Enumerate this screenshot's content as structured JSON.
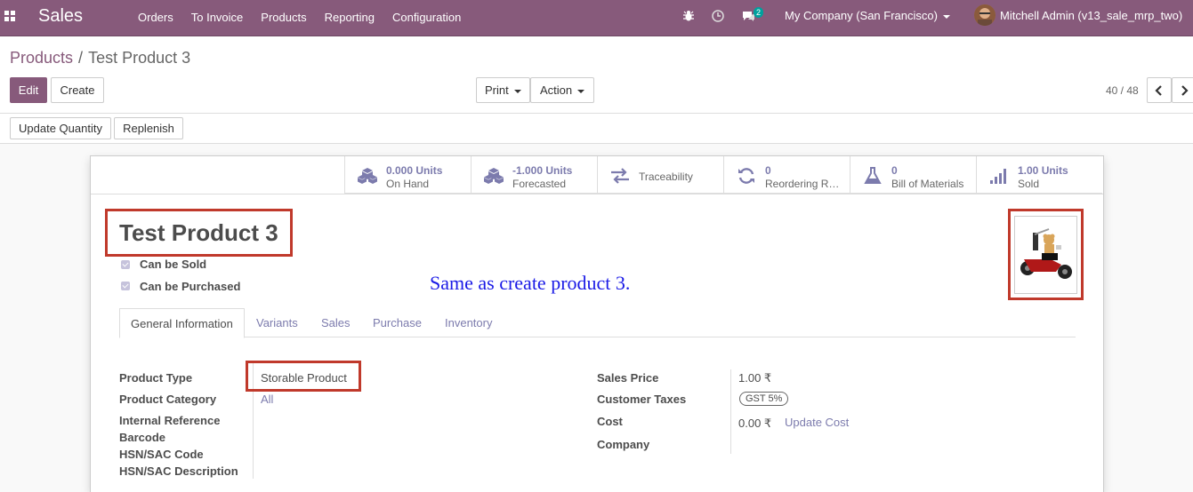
{
  "nav": {
    "app_name": "Sales",
    "menu": [
      "Orders",
      "To Invoice",
      "Products",
      "Reporting",
      "Configuration"
    ],
    "message_count": "2",
    "company": "My Company (San Francisco)",
    "user": "Mitchell Admin (v13_sale_mrp_two)"
  },
  "breadcrumb": {
    "parent": "Products",
    "separator": "/",
    "current": "Test Product 3"
  },
  "buttons": {
    "edit": "Edit",
    "create": "Create",
    "print": "Print",
    "action": "Action",
    "update_quantity": "Update Quantity",
    "replenish": "Replenish"
  },
  "pager": {
    "value": "40 / 48"
  },
  "stats": [
    {
      "value": "0.000 Units",
      "label": "On Hand",
      "icon": "cubes-icon"
    },
    {
      "value": "-1.000 Units",
      "label": "Forecasted",
      "icon": "cubes-icon"
    },
    {
      "label": "Traceability",
      "icon": "exchange-icon"
    },
    {
      "value": "0",
      "label": "Reordering Rules",
      "icon": "refresh-icon"
    },
    {
      "value": "0",
      "label": "Bill of Materials",
      "icon": "flask-icon"
    },
    {
      "value": "1.00 Units",
      "label": "Sold",
      "icon": "signal-icon"
    }
  ],
  "product": {
    "name": "Test Product 3",
    "can_be_sold": "Can be Sold",
    "can_be_purchased": "Can be Purchased"
  },
  "annotation": "Same as create product 3.",
  "tabs": [
    "General Information",
    "Variants",
    "Sales",
    "Purchase",
    "Inventory"
  ],
  "general": {
    "left": {
      "product_type_label": "Product Type",
      "product_type_value": "Storable Product",
      "product_category_label": "Product Category",
      "product_category_value": "All",
      "internal_reference_label": "Internal Reference",
      "barcode_label": "Barcode",
      "hsn_code_label": "HSN/SAC Code",
      "hsn_desc_label": "HSN/SAC Description"
    },
    "right": {
      "sales_price_label": "Sales Price",
      "sales_price_value": "1.00 ₹",
      "customer_taxes_label": "Customer Taxes",
      "customer_taxes_value": "GST 5%",
      "cost_label": "Cost",
      "cost_value": "0.00 ₹",
      "update_cost": "Update Cost",
      "company_label": "Company"
    }
  },
  "colors": {
    "primary": "#875a7b",
    "accent": "#7c7bad",
    "highlight": "#c0392b",
    "annotation": "#1a1ae6"
  }
}
